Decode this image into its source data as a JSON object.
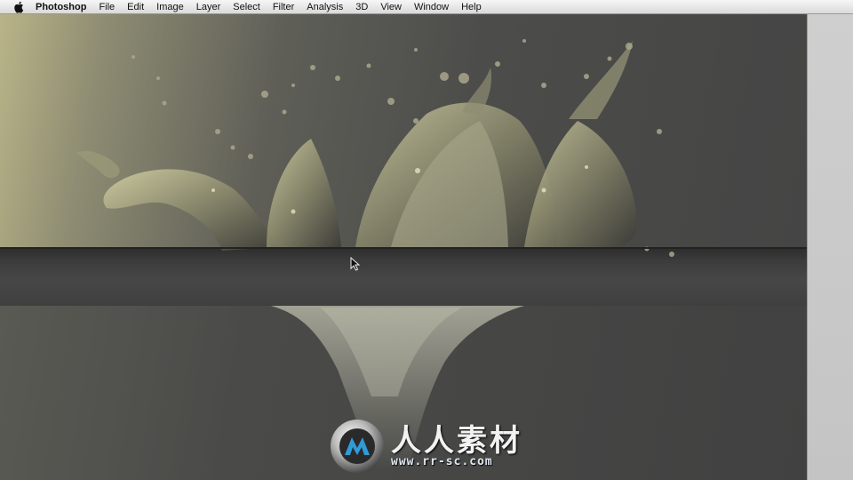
{
  "menubar": {
    "apple_icon": "apple-logo-icon",
    "app_name": "Photoshop",
    "items": [
      "File",
      "Edit",
      "Image",
      "Layer",
      "Select",
      "Filter",
      "Analysis",
      "3D",
      "View",
      "Window",
      "Help"
    ]
  },
  "canvas": {
    "cursor_icon": "arrow-cursor-icon"
  },
  "watermark": {
    "title": "人人素材",
    "url": "www.rr-sc.com",
    "logo_icon": "rr-sc-logo-icon"
  },
  "colors": {
    "menubar": "#e6e6e6",
    "canvas_highlight": "#b9b488",
    "canvas_dark": "#444444",
    "right_strip": "#c8c8c8"
  }
}
